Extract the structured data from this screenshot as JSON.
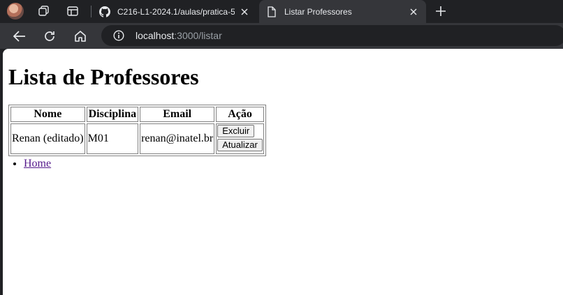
{
  "browser": {
    "tabs": [
      {
        "title": "C216-L1-2024.1/aulas/pratica-5/",
        "icon": "github-icon",
        "active": false
      },
      {
        "title": "Listar Professores",
        "icon": "page-icon",
        "active": true
      }
    ],
    "address": {
      "host": "localhost",
      "path": ":3000/listar"
    },
    "colors": {
      "tabstrip": "#202124",
      "toolbar": "#35363a",
      "omnibox": "#202124",
      "visited_link": "#551a8b"
    }
  },
  "page": {
    "heading": "Lista de Professores",
    "table": {
      "headers": [
        "Nome",
        "Disciplina",
        "Email",
        "Ação"
      ],
      "rows": [
        {
          "nome": "Renan (editado)",
          "disciplina": "M01",
          "email": "renan@inatel.br",
          "actions": [
            "Excluir",
            "Atualizar"
          ]
        }
      ]
    },
    "links": [
      "Home"
    ]
  }
}
